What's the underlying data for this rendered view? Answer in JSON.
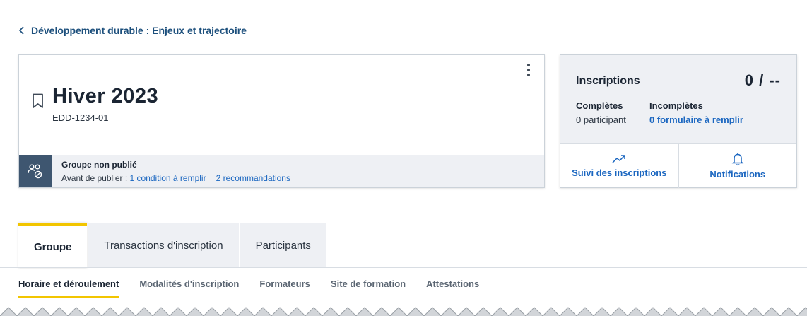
{
  "breadcrumb": {
    "label": "Développement durable : Enjeux et trajectoire"
  },
  "group": {
    "title": "Hiver 2023",
    "code": "EDD-1234-01",
    "status_title": "Groupe non publié",
    "status_prefix": "Avant de publier : ",
    "condition_link": "1 condition à remplir",
    "recommendation_link": "2 recommandations"
  },
  "inscriptions": {
    "title": "Inscriptions",
    "count": "0 / --",
    "completed_label": "Complètes",
    "completed_value": "0 participant",
    "incomplete_label": "Incomplètes",
    "incomplete_link": "0 formulaire à remplir",
    "actions": [
      {
        "label": "Suivi des inscriptions",
        "icon": "trending-up-icon"
      },
      {
        "label": "Notifications",
        "icon": "bell-icon"
      }
    ]
  },
  "tabs": [
    {
      "label": "Groupe",
      "active": true
    },
    {
      "label": "Transactions d'inscription",
      "active": false
    },
    {
      "label": "Participants",
      "active": false
    }
  ],
  "subtabs": [
    {
      "label": "Horaire et déroulement",
      "active": true
    },
    {
      "label": "Modalités d'inscription",
      "active": false
    },
    {
      "label": "Formateurs",
      "active": false
    },
    {
      "label": "Site de formation",
      "active": false
    },
    {
      "label": "Attestations",
      "active": false
    }
  ],
  "colors": {
    "accent": "#f2c500",
    "link": "#1a66c0",
    "status_icon_bg": "#3e5670",
    "panel_bg": "#eef0f4"
  }
}
